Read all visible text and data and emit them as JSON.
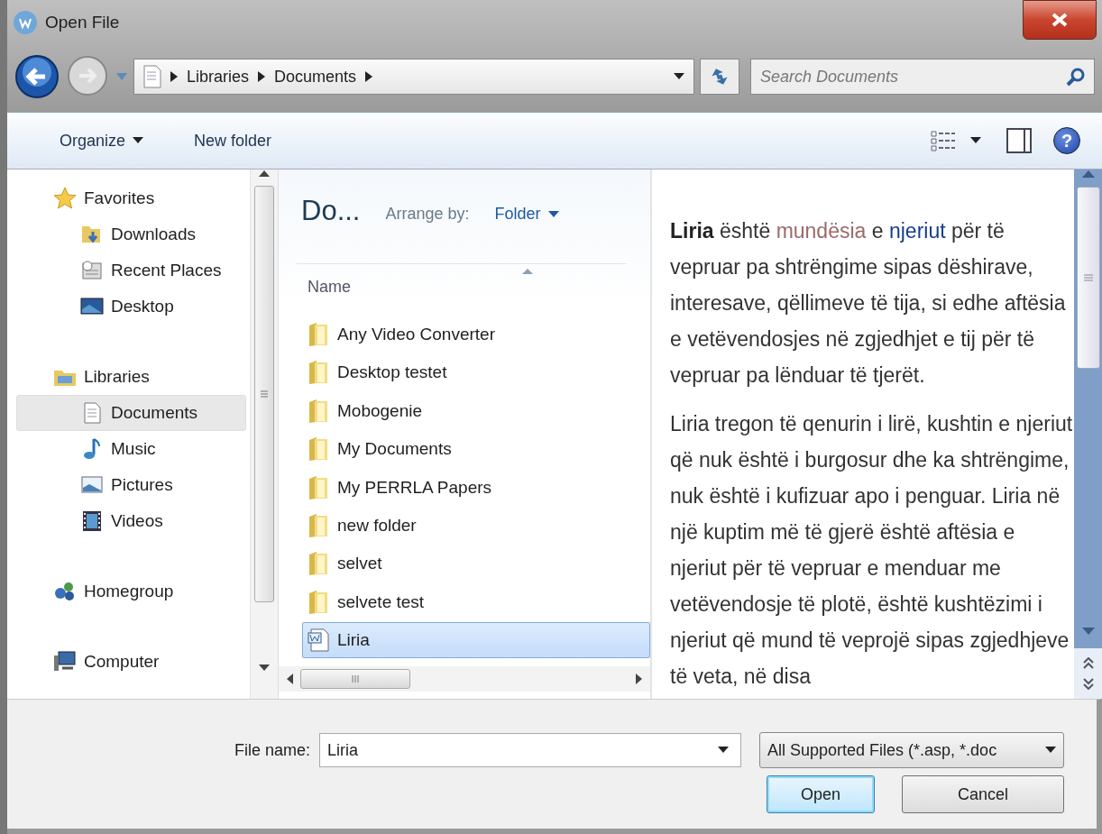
{
  "window": {
    "title": "Open File"
  },
  "address_bar": {
    "crumbs": [
      "Libraries",
      "Documents"
    ]
  },
  "search": {
    "placeholder": "Search Documents"
  },
  "toolbar": {
    "organize": "Organize",
    "new_folder": "New folder",
    "help": "?"
  },
  "navigation": [
    {
      "label": "Favorites",
      "kind": "favorites",
      "selected": false,
      "children": [
        {
          "label": "Downloads",
          "kind": "downloads",
          "selected": false
        },
        {
          "label": "Recent Places",
          "kind": "recent",
          "selected": false
        },
        {
          "label": "Desktop",
          "kind": "desktop",
          "selected": false
        }
      ]
    },
    {
      "label": "Libraries",
      "kind": "libraries",
      "selected": false,
      "children": [
        {
          "label": "Documents",
          "kind": "documents",
          "selected": true
        },
        {
          "label": "Music",
          "kind": "music",
          "selected": false
        },
        {
          "label": "Pictures",
          "kind": "pictures",
          "selected": false
        },
        {
          "label": "Videos",
          "kind": "videos",
          "selected": false
        }
      ]
    },
    {
      "label": "Homegroup",
      "kind": "homegroup",
      "selected": false
    },
    {
      "label": "Computer",
      "kind": "computer",
      "selected": false
    }
  ],
  "file_list": {
    "heading": "Do...",
    "arrange_label": "Arrange by:",
    "arrange_value": "Folder",
    "columns": [
      "Name"
    ],
    "rows": [
      {
        "name": "Any Video Converter",
        "kind": "folder",
        "selected": false
      },
      {
        "name": "Desktop testet",
        "kind": "folder",
        "selected": false
      },
      {
        "name": "Mobogenie",
        "kind": "folder",
        "selected": false
      },
      {
        "name": "My Documents",
        "kind": "folder",
        "selected": false
      },
      {
        "name": "My PERRLA Papers",
        "kind": "folder",
        "selected": false
      },
      {
        "name": "new folder",
        "kind": "folder",
        "selected": false
      },
      {
        "name": "selvet",
        "kind": "folder",
        "selected": false
      },
      {
        "name": "selvete test",
        "kind": "folder",
        "selected": false
      },
      {
        "name": "Liria",
        "kind": "document",
        "selected": true
      }
    ]
  },
  "preview": {
    "paragraphs": [
      [
        {
          "text": "Liria",
          "kind": "bold"
        },
        {
          "text": " është ",
          "kind": "plain"
        },
        {
          "text": "mundësia",
          "kind": "visited-link"
        },
        {
          "text": " e ",
          "kind": "plain"
        },
        {
          "text": "njeriut",
          "kind": "link"
        },
        {
          "text": " për të vepruar pa shtrëngime sipas dëshirave, interesave, qëllimeve të tija, si edhe aftësia e vetëvendosjes në zgjedhjet e tij për të vepruar pa lënduar të tjerët.",
          "kind": "plain"
        }
      ],
      [
        {
          "text": "Liria tregon të qenurin i lirë, kushtin e njeriut që nuk është i burgosur dhe ka shtrëngime, nuk është i kufizuar apo i penguar. Liria në një kuptim më të gjerë është aftësia e njeriut për të vepruar e menduar me vetëvendosje të plotë, është kushtëzimi i njeriut që mund të veprojë sipas zgjedhjeve të veta, në disa",
          "kind": "plain"
        }
      ]
    ]
  },
  "footer": {
    "file_name_label": "File name:",
    "file_name": "Liria",
    "filter": "All Supported Files (*.asp, *.doc",
    "buttons": [
      {
        "label": "Open",
        "kind": "default"
      },
      {
        "label": "Cancel",
        "kind": "normal"
      }
    ]
  }
}
